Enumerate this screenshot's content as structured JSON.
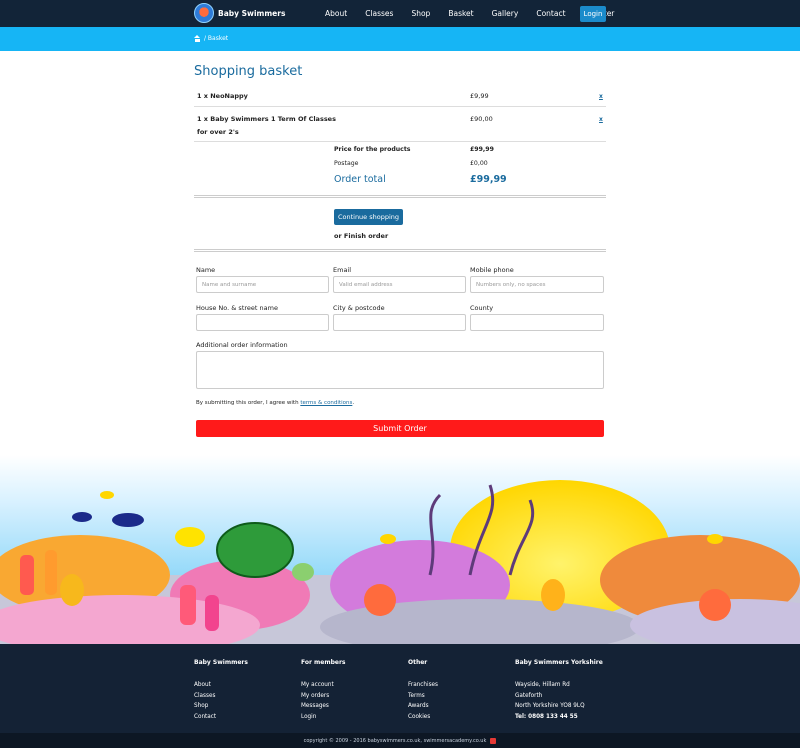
{
  "header": {
    "brand": "Baby Swimmers",
    "nav": [
      "About",
      "Classes",
      "Shop",
      "Basket",
      "Gallery",
      "Contact",
      "Register"
    ],
    "login": "Login"
  },
  "breadcrumb": {
    "current": "/ Basket"
  },
  "basket": {
    "title": "Shopping basket",
    "items": [
      {
        "name": "1 x NeoNappy",
        "price": "£9,99",
        "remove": "x"
      },
      {
        "name": "1 x Baby Swimmers 1 Term Of Classes for over 2's",
        "price": "£90,00",
        "remove": "x"
      }
    ],
    "summary": {
      "products_label": "Price for the products",
      "products_value": "£99,99",
      "postage_label": "Postage",
      "postage_value": "£0,00",
      "total_label": "Order total",
      "total_value": "£99,99"
    },
    "continue": "Continue shopping",
    "finish": "or Finish order"
  },
  "form": {
    "name_label": "Name",
    "name_placeholder": "Name and surname",
    "email_label": "Email",
    "email_placeholder": "Valid email address",
    "mobile_label": "Mobile phone",
    "mobile_placeholder": "Numbers only, no spaces",
    "street_label": "House No. & street name",
    "city_label": "City & postcode",
    "county_label": "County",
    "info_label": "Additional order information",
    "terms_prefix": "By submitting this order, I agree with",
    "terms_link": "terms & conditions",
    "terms_suffix": ".",
    "submit": "Submit Order"
  },
  "footer": {
    "columns": [
      {
        "title": "Baby Swimmers",
        "links": [
          "About",
          "Classes",
          "Shop",
          "Contact"
        ]
      },
      {
        "title": "For members",
        "links": [
          "My account",
          "My orders",
          "Messages",
          "Login"
        ]
      },
      {
        "title": "Other",
        "links": [
          "Franchises",
          "Terms",
          "Awards",
          "Cookies"
        ]
      },
      {
        "title": "Baby Swimmers Yorkshire",
        "links": [
          "Wayside, Hillam Rd",
          "Gateforth",
          "North Yorkshire YO8 9LQ",
          "Tel: 0808 133 44 55"
        ]
      }
    ],
    "copyright": "copyright © 2009 - 2016 babyswimmers.co.uk, swimmersacademy.co.uk"
  },
  "colors": {
    "header": "#122438",
    "accent": "#16b5f5",
    "primary": "#1a6b9e",
    "submit": "#ff1a1a"
  }
}
